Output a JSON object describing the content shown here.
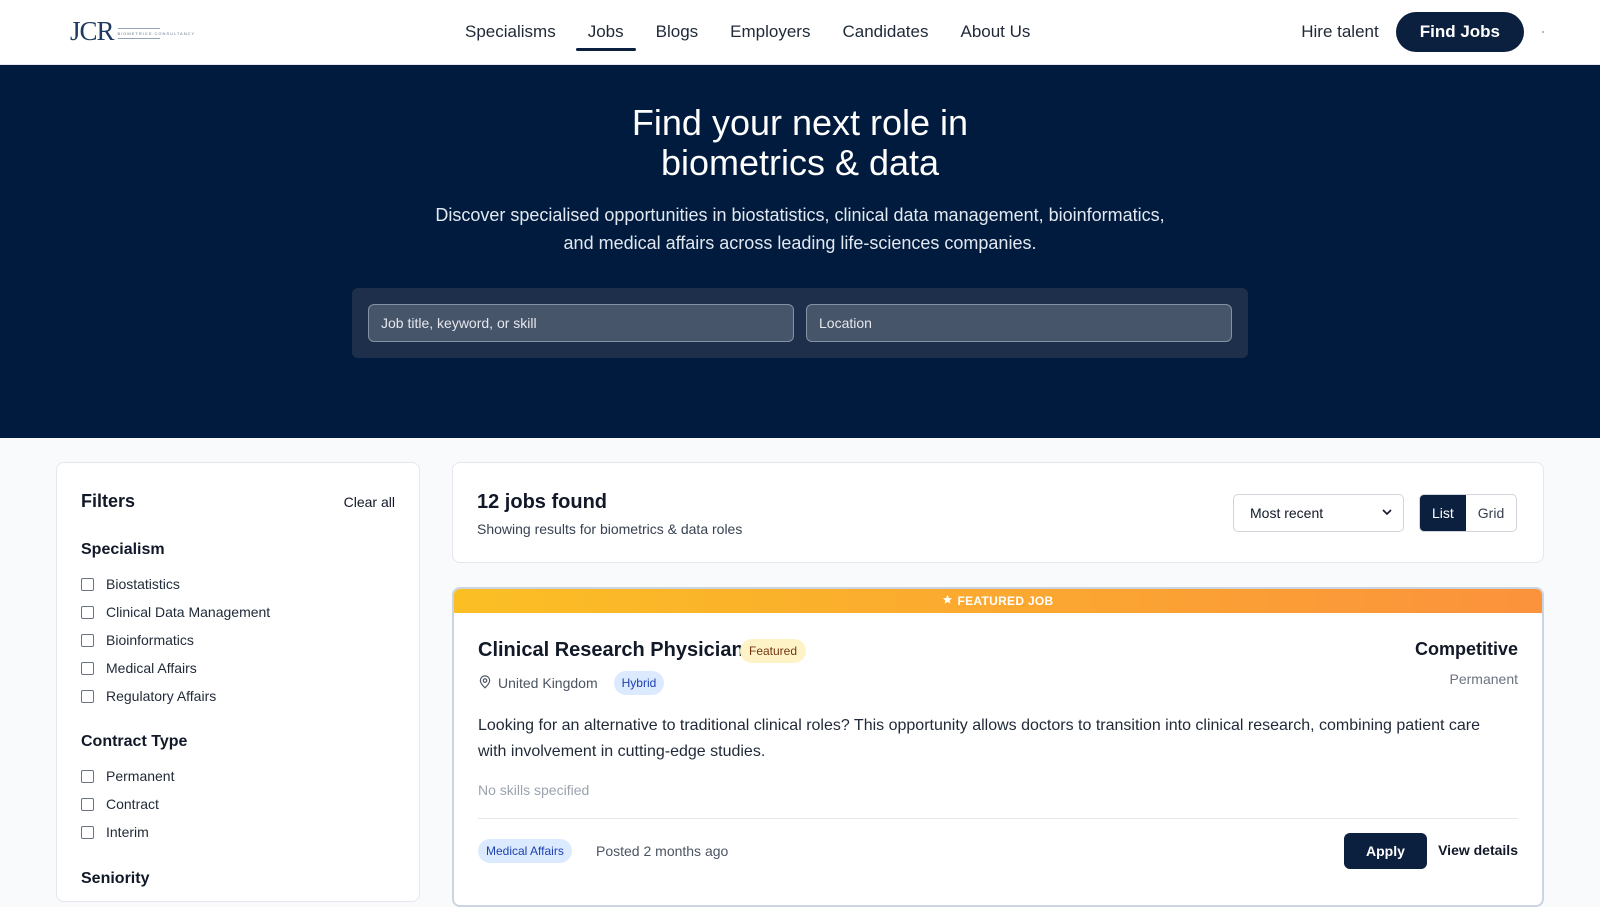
{
  "brand": {
    "logo_text": "JCR",
    "logo_sub": "BIOMETRICS CONSULTANCY"
  },
  "nav": {
    "links": [
      "Specialisms",
      "Jobs",
      "Blogs",
      "Employers",
      "Candidates",
      "About Us"
    ],
    "active": "Jobs",
    "hire_talent": "Hire talent",
    "find_jobs": "Find Jobs"
  },
  "hero": {
    "title_line1": "Find your next role in",
    "title_line2": "biometrics & data",
    "subtitle_line1": "Discover specialised opportunities in biostatistics, clinical data management, bioinformatics,",
    "subtitle_line2": "and medical affairs across leading life-sciences companies.",
    "keyword_placeholder": "Job title, keyword, or skill",
    "location_placeholder": "Location"
  },
  "filters": {
    "title": "Filters",
    "clear_all": "Clear all",
    "groups": [
      {
        "title": "Specialism",
        "options": [
          "Biostatistics",
          "Clinical Data Management",
          "Bioinformatics",
          "Medical Affairs",
          "Regulatory Affairs"
        ]
      },
      {
        "title": "Contract Type",
        "options": [
          "Permanent",
          "Contract",
          "Interim"
        ]
      },
      {
        "title": "Seniority",
        "options": []
      }
    ]
  },
  "results": {
    "count_text": "12 jobs found",
    "showing_text": "Showing results for biometrics & data roles",
    "sort_value": "Most recent",
    "view_list": "List",
    "view_grid": "Grid",
    "view_selected": "List"
  },
  "job": {
    "banner": "FEATURED JOB",
    "title": "Clinical Research Physician",
    "featured_badge": "Featured",
    "location": "United Kingdom",
    "work_mode": "Hybrid",
    "salary": "Competitive",
    "contract_type": "Permanent",
    "description_line1": "Looking for an alternative to traditional clinical roles? This opportunity allows doctors to transition into clinical research, combining patient care",
    "description_line2": "with involvement in cutting-edge studies.",
    "skills_text": "No skills specified",
    "category": "Medical Affairs",
    "posted": "Posted 2 months ago",
    "apply_label": "Apply",
    "view_details_label": "View details"
  },
  "colors": {
    "primary": "#0b1f3f",
    "hero_bg": "#001b3d",
    "featured_gradient_start": "#fbbf24",
    "featured_gradient_end": "#fb923c",
    "badge_blue_bg": "#dbeafe",
    "badge_blue_text": "#1e40af"
  },
  "icons": {
    "location": "map-pin-icon",
    "featured": "star-icon",
    "sort": "chevron-down-icon"
  }
}
